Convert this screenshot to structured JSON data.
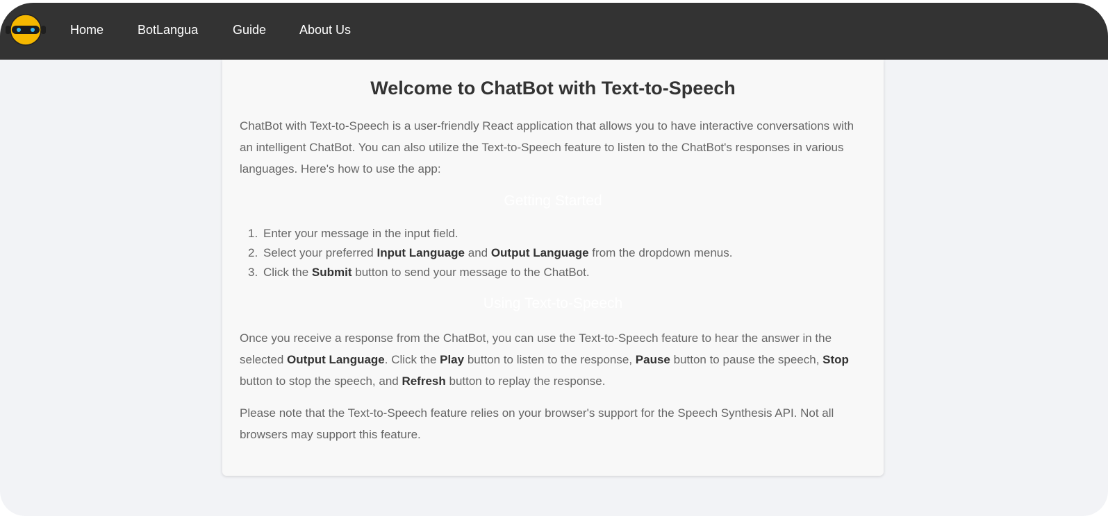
{
  "nav": {
    "logo_name": "robot-logo",
    "links": [
      {
        "label": "Home"
      },
      {
        "label": "BotLangua"
      },
      {
        "label": "Guide"
      },
      {
        "label": "About Us"
      }
    ]
  },
  "colors": {
    "navbar": "#333333",
    "background": "#f2f3f6",
    "card": "#f8f8f8",
    "logo_yellow": "#f5b800"
  },
  "main": {
    "title": "Welcome to ChatBot with Text-to-Speech",
    "intro": "ChatBot with Text-to-Speech is a user-friendly React application that allows you to have interactive conversations with an intelligent ChatBot. You can also utilize the Text-to-Speech feature to listen to the ChatBot's responses in various languages. Here's how to use the app:",
    "getting_started": {
      "heading": "Getting Started",
      "steps": [
        {
          "num": "1.",
          "t1": "Enter your message in the input field."
        },
        {
          "num": "2.",
          "t1": "Select your preferred ",
          "b1": "Input Language",
          "t2": " and ",
          "b2": "Output Language",
          "t3": " from the dropdown menus."
        },
        {
          "num": "3.",
          "t1": "Click the ",
          "b1": "Submit",
          "t2": " button to send your message to the ChatBot."
        }
      ]
    },
    "tts": {
      "heading": "Using Text-to-Speech",
      "p1": {
        "t1": "Once you receive a response from the ChatBot, you can use the Text-to-Speech feature to hear the answer in the selected ",
        "b1": "Output Language",
        "t2": ". Click the ",
        "b2": "Play",
        "t3": " button to listen to the response, ",
        "b3": "Pause",
        "t4": " button to pause the speech, ",
        "b4": "Stop",
        "t5": " button to stop the speech, and ",
        "b5": "Refresh",
        "t6": " button to replay the response."
      },
      "note": "Please note that the Text-to-Speech feature relies on your browser's support for the Speech Synthesis API. Not all browsers may support this feature."
    }
  }
}
